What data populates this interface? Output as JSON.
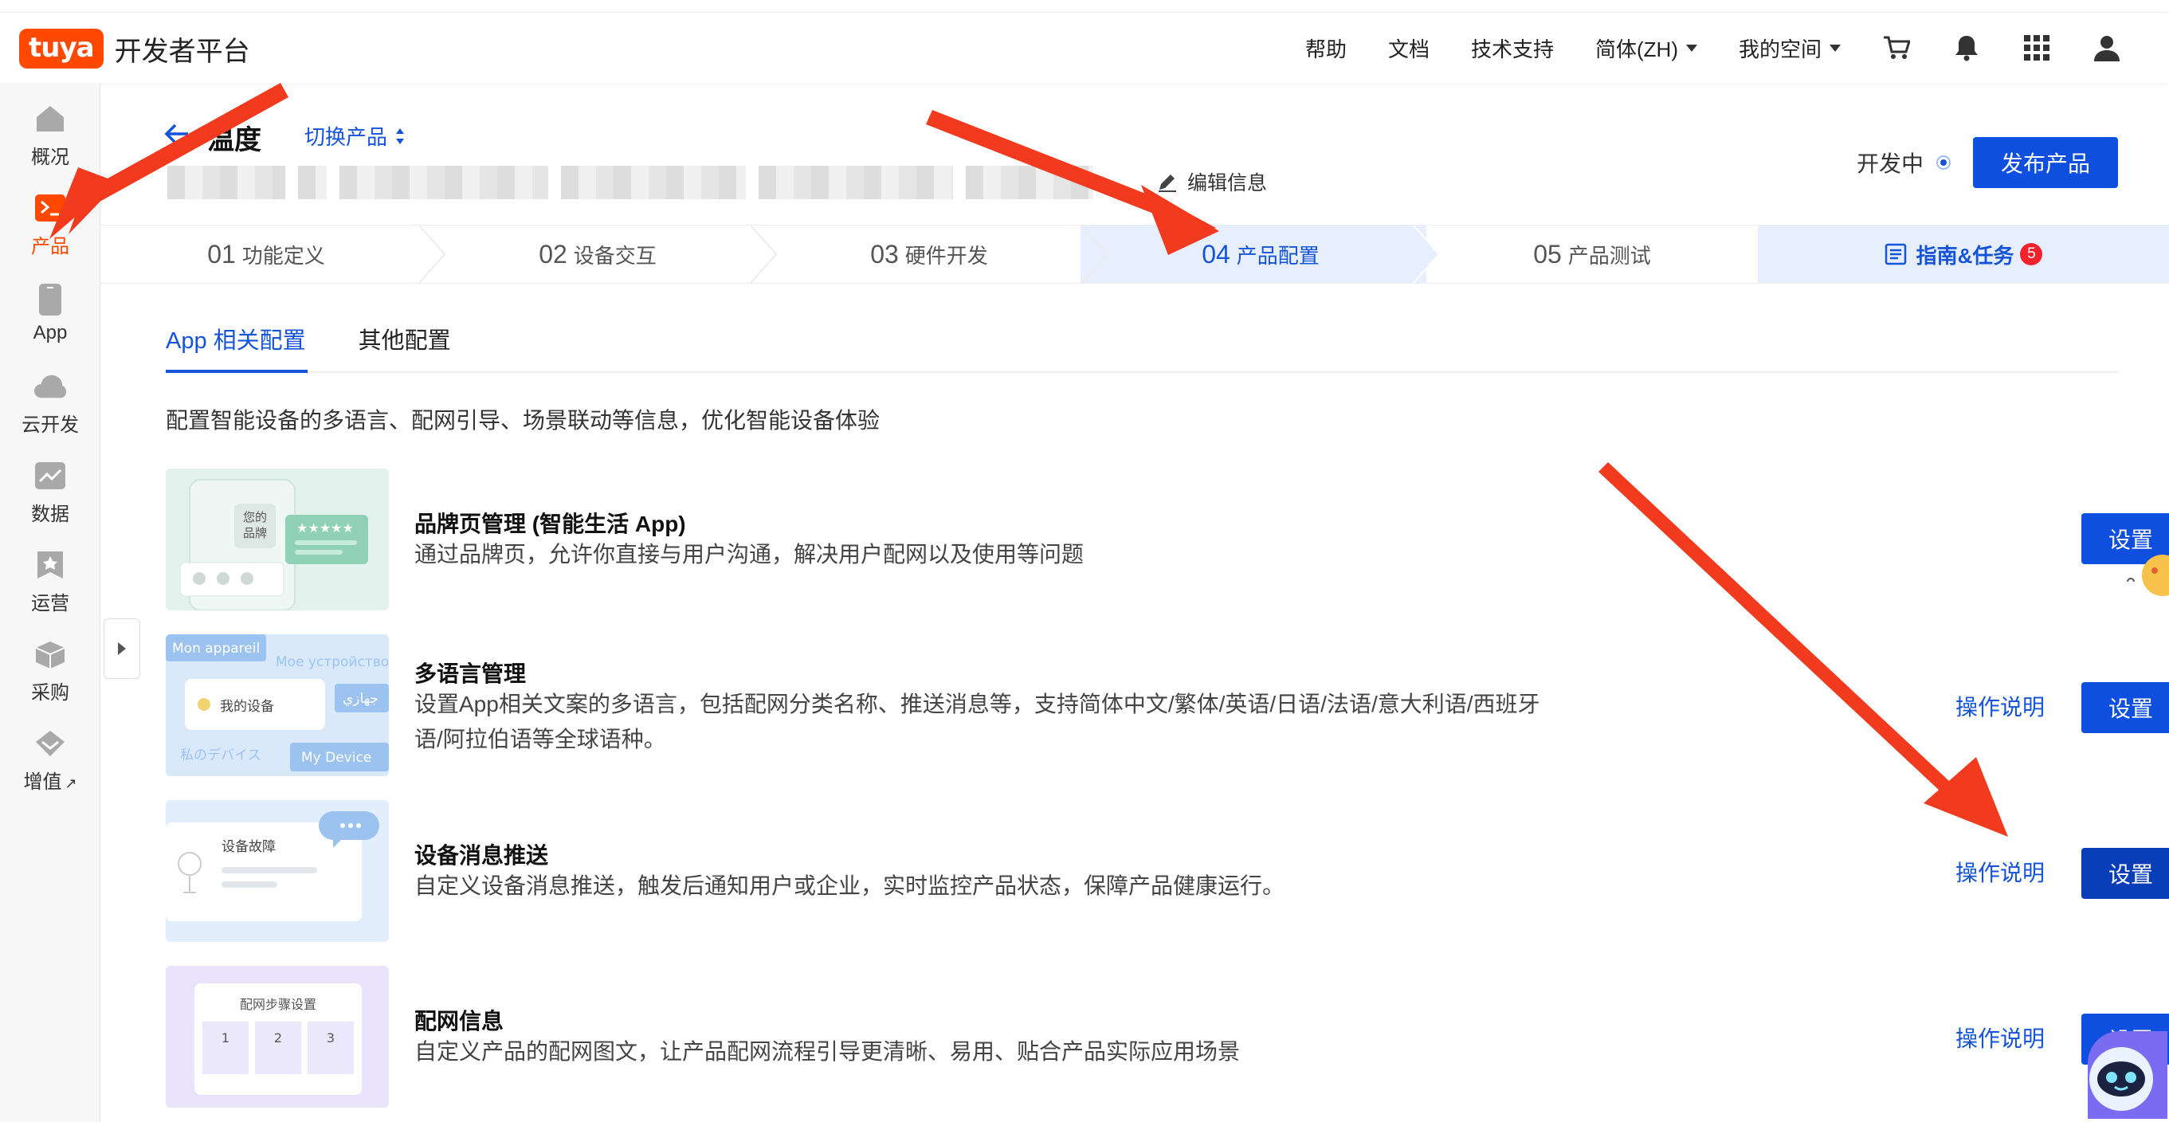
{
  "header": {
    "logo_badge": "tuya",
    "logo_text": "开发者平台",
    "nav": {
      "help": "帮助",
      "docs": "文档",
      "support": "技术支持",
      "language": "简体(ZH)",
      "workspace": "我的空间"
    },
    "icons": [
      "cart-icon",
      "bell-icon",
      "apps-grid-icon",
      "user-icon"
    ]
  },
  "sidebar": {
    "items": [
      {
        "label": "概况",
        "icon": "home-icon"
      },
      {
        "label": "产品",
        "icon": "terminal-icon",
        "active": true
      },
      {
        "label": "App",
        "icon": "phone-icon"
      },
      {
        "label": "云开发",
        "icon": "cloud-icon"
      },
      {
        "label": "数据",
        "icon": "chart-icon"
      },
      {
        "label": "运营",
        "icon": "star-bookmark-icon"
      },
      {
        "label": "采购",
        "icon": "box-icon"
      },
      {
        "label": "增值",
        "icon": "diamond-icon",
        "external": "↗"
      }
    ]
  },
  "product": {
    "name": "温度",
    "switch_label": "切换产品",
    "edit_label": "编辑信息",
    "status": "开发中",
    "publish_label": "发布产品"
  },
  "steps": [
    {
      "num": "01",
      "label": "功能定义"
    },
    {
      "num": "02",
      "label": "设备交互"
    },
    {
      "num": "03",
      "label": "硬件开发"
    },
    {
      "num": "04",
      "label": "产品配置",
      "active": true
    },
    {
      "num": "05",
      "label": "产品测试"
    }
  ],
  "guide": {
    "label": "指南&任务",
    "count": "5"
  },
  "tabs": [
    {
      "label": "App 相关配置",
      "active": true
    },
    {
      "label": "其他配置"
    }
  ],
  "intro": "配置智能设备的多语言、配网引导、场景联动等信息，优化智能设备体验",
  "rows": [
    {
      "title": "品牌页管理 (智能生活 App)",
      "desc": "通过品牌页，允许你直接与用户沟通，解决用户配网以及使用等问题",
      "op": "",
      "set": "设置",
      "thumb": {
        "brand_line1": "您的",
        "brand_line2": "品牌",
        "stars": "★★★★★"
      }
    },
    {
      "title": "多语言管理",
      "desc": "设置App相关文案的多语言，包括配网分类名称、推送消息等，支持简体中文/繁体/英语/日语/法语/意大利语/西班牙语/阿拉伯语等全球语种。",
      "op": "操作说明",
      "set": "设置",
      "thumb": {
        "fr": "Mon appareil",
        "ru": "Мое устройство",
        "zh": "我的设备",
        "ar": "جهازي",
        "ja": "私のデバイス",
        "en": "My Device"
      }
    },
    {
      "title": "设备消息推送",
      "desc": "自定义设备消息推送，触发后通知用户或企业，实时监控产品状态，保障产品健康运行。",
      "op": "操作说明",
      "set": "设置",
      "thumb": {
        "fault": "设备故障"
      }
    },
    {
      "title": "配网信息",
      "desc": "自定义产品的配网图文，让产品配网流程引导更清晰、易用、贴合产品实际应用场景",
      "op": "操作说明",
      "set": "设置",
      "thumb": {
        "steps_title": "配网步骤设置",
        "s1": "1",
        "s2": "2",
        "s3": "3"
      }
    }
  ],
  "colors": {
    "brand_orange": "#ff4800",
    "primary_blue": "#0f4fe0",
    "link_blue": "#1554d8",
    "annotation_red": "#f23a1e"
  }
}
